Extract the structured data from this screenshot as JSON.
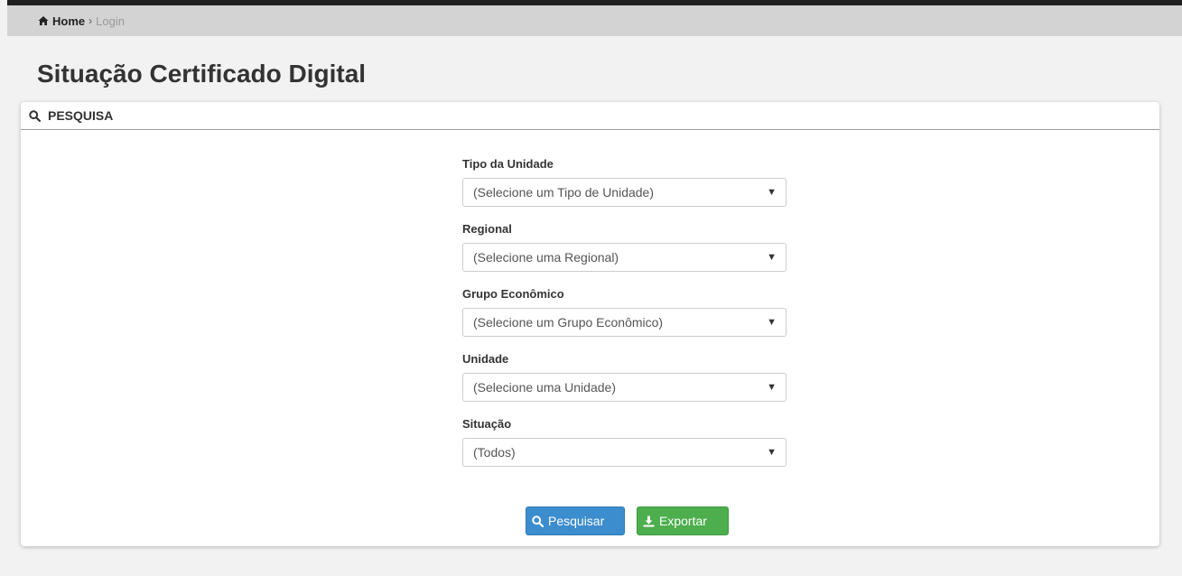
{
  "breadcrumb": {
    "home_icon": "home-icon",
    "home_label": "Home",
    "separator": "›",
    "current": "Login"
  },
  "page": {
    "title": "Situação Certificado Digital"
  },
  "panel": {
    "title": "PESQUISA",
    "icon": "search-icon"
  },
  "form": {
    "fields": [
      {
        "label": "Tipo da Unidade",
        "value": "(Selecione um Tipo de Unidade)"
      },
      {
        "label": "Regional",
        "value": "(Selecione uma Regional)"
      },
      {
        "label": "Grupo Econômico",
        "value": "(Selecione um Grupo Econômico)"
      },
      {
        "label": "Unidade",
        "value": "(Selecione uma Unidade)"
      },
      {
        "label": "Situação",
        "value": "(Todos)"
      }
    ],
    "dropdown_arrow": "▼"
  },
  "actions": {
    "search_label": "Pesquisar",
    "export_label": "Exportar"
  },
  "colors": {
    "primary": "#3c8dcd",
    "success": "#4cae4c",
    "breadcrumb_bg": "#d3d3d3",
    "page_bg": "#f2f2f2"
  }
}
